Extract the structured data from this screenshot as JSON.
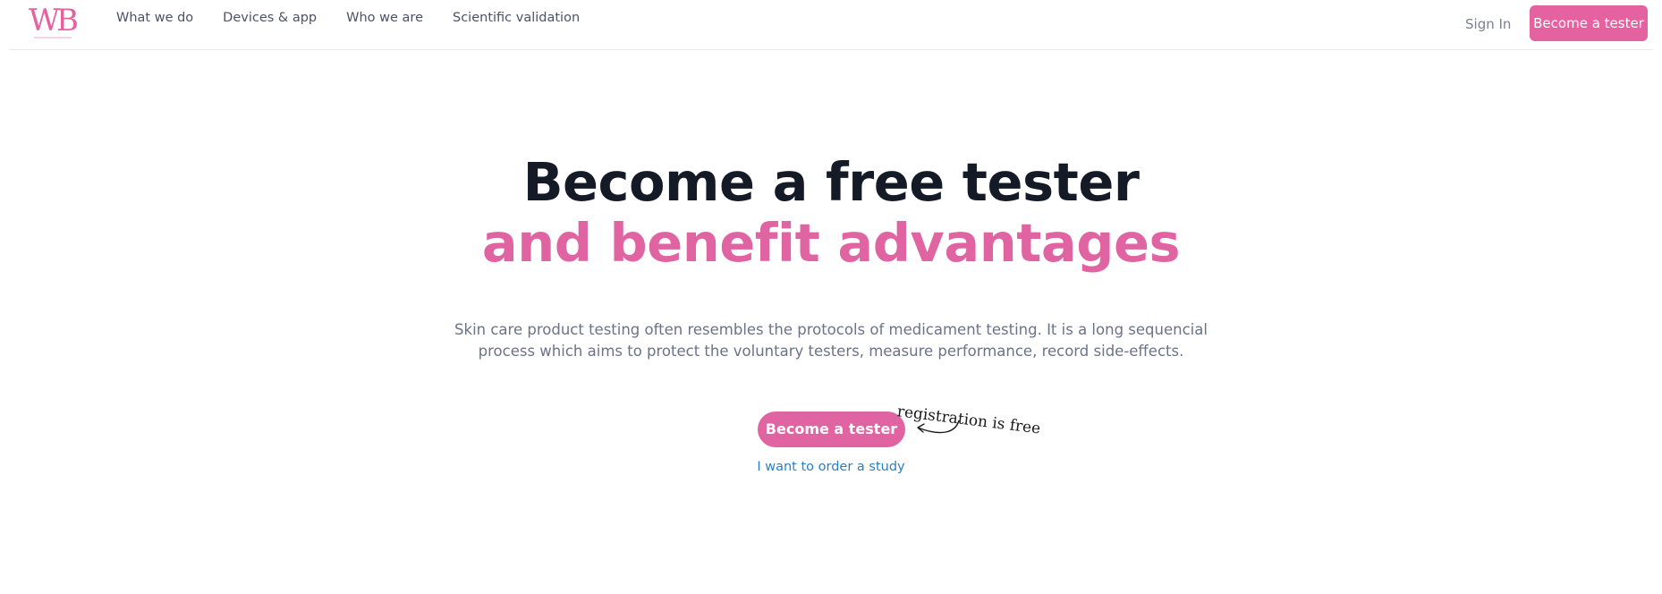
{
  "brand": {
    "logo_text": "WB",
    "accent_color": "#e462a0"
  },
  "nav": {
    "items": [
      {
        "label": "What we do"
      },
      {
        "label": "Devices & app"
      },
      {
        "label": "Who we are"
      },
      {
        "label": "Scientific validation"
      }
    ],
    "sign_in_label": "Sign In",
    "cta_label": "Become a tester"
  },
  "hero": {
    "title_line1": "Become a free tester",
    "title_line2": "and benefit advantages",
    "description_line1": "Skin care product testing often resembles the protocols of medicament testing. It is a long sequencial",
    "description_line2": "process which aims to protect the voluntary testers, measure performance, record side-effects.",
    "primary_cta_label": "Become a tester",
    "annotation": "registration is free",
    "secondary_link_label": "I want to order a study"
  }
}
